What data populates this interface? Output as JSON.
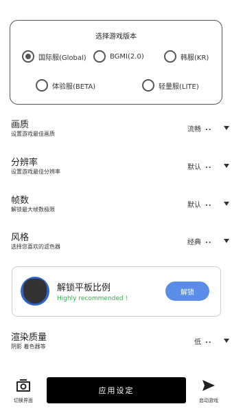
{
  "version_selector": {
    "title": "选择游戏版本",
    "options": [
      {
        "label": "国际服(Global)",
        "selected": true
      },
      {
        "label": "BGMI(2.0)",
        "selected": false
      },
      {
        "label": "韩服(KR)",
        "selected": false
      },
      {
        "label": "体验服(BETA)",
        "selected": false
      },
      {
        "label": "轻量服(LITE)",
        "selected": false
      }
    ]
  },
  "settings": [
    {
      "title": "画质",
      "desc": "设置游戏最佳画质",
      "value": "流畅",
      "dots": ".."
    },
    {
      "title": "分辨率",
      "desc": "设置游戏最佳分辨率",
      "value": "默认",
      "dots": ".."
    },
    {
      "title": "帧数",
      "desc": "解锁最大帧数极限",
      "value": "默认",
      "dots": ".."
    },
    {
      "title": "风格",
      "desc": "选择您喜欢的滤色器",
      "value": "经典",
      "dots": ".."
    },
    {
      "title": "渲染质量",
      "desc": "阴影 着色器等",
      "value": "低",
      "dots": ".."
    }
  ],
  "unlock_card": {
    "title": "解锁平板比例",
    "subtitle": "Highly recommended !",
    "button": "解锁"
  },
  "bottom_bar": {
    "switch_label": "切换界面",
    "apply_label": "应用设定",
    "launch_label": "启动游戏"
  },
  "colors": {
    "accent_button": "#5b8de8",
    "recommend_green": "#2fb04a",
    "primary_button": "#000000"
  },
  "icons": {
    "switch": "camera-switch-icon",
    "launch": "send-icon"
  }
}
